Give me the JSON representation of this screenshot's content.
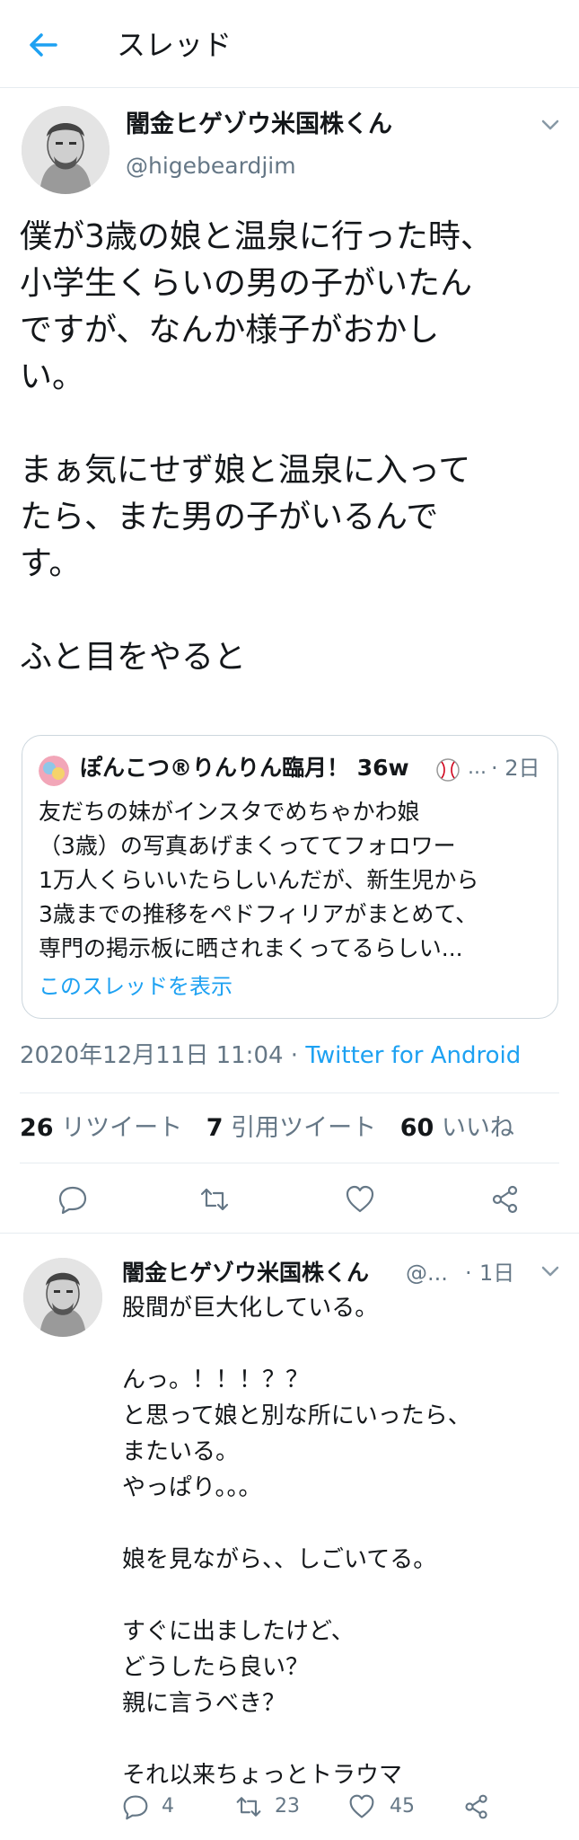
{
  "header": {
    "title": "スレッド",
    "back_icon": "back-arrow-icon",
    "accent": "#1da1f2"
  },
  "main_tweet": {
    "author_name": "闇金ヒゲゾウ米国株くん",
    "author_handle": "@higebeardjim",
    "body": "僕が3歳の娘と温泉に行った時、\n小学生くらいの男の子がいたん\nですが、なんか様子がおかし\nい。\n\nまぁ気にせず娘と温泉に入って\nたら、また男の子がいるんで\nす。\n\nふと目をやると",
    "timestamp": "2020年12月11日 11:04",
    "separator": " · ",
    "client": "Twitter for Android",
    "retweets": "26",
    "retweets_label": "リツイート",
    "quotes": "7",
    "quotes_label": "引用ツイート",
    "likes": "60",
    "likes_label": "いいね"
  },
  "quoted_tweet": {
    "author_name": "ぽんこつ®りんりん臨月！ 36w",
    "ellipsis": "...",
    "time": "· 2日",
    "body": "友だちの妹がインスタでめちゃかわ娘\n（3歳）の写真あげまくっててフォロワー\n1万人くらいいたらしいんだが、新生児から\n3歳までの推移をペドフィリアがまとめて、\n専門の掲示板に晒されまくってるらしい...",
    "show_thread": "このスレッドを表示"
  },
  "reply_tweet": {
    "author_name": "闇金ヒゲゾウ米国株くん",
    "author_handle": "@...",
    "dot": "·",
    "time": "1日",
    "body": "股間が巨大化している。\n\nんっ。！！！？？\nと思って娘と別な所にいったら、\nまたいる。\nやっぱり。。。\n\n娘を見ながら、、しごいてる。\n\nすぐに出ましたけど、\nどうしたら良い？\n親に言うべき？\n\nそれ以来ちょっとトラウマ",
    "reply_count": "4",
    "retweet_count": "23",
    "like_count": "45"
  }
}
